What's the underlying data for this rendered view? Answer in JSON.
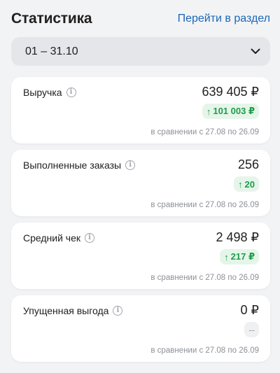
{
  "header": {
    "title": "Статистика",
    "link": "Перейти в раздел"
  },
  "period": {
    "value": "01 – 31.10"
  },
  "cards": [
    {
      "label": "Выручка",
      "value": "639 405 ₽",
      "delta": "101 003 ₽",
      "compare": "в сравнении с 27.08 по 26.09"
    },
    {
      "label": "Выполненные заказы",
      "value": "256",
      "delta": "20",
      "compare": "в сравнении с 27.08 по 26.09"
    },
    {
      "label": "Средний чек",
      "value": "2 498 ₽",
      "delta": "217 ₽",
      "compare": "в сравнении с 27.08 по 26.09"
    },
    {
      "label": "Упущенная выгода",
      "value": "0 ₽",
      "delta": "--",
      "compare": "в сравнении с 27.08 по 26.09"
    }
  ],
  "icons": {
    "info": "info-icon",
    "chevron": "chevron-down-icon",
    "arrow": "arrow-up-icon"
  },
  "colors": {
    "link": "#1a66b8",
    "positive": "#1e9e48",
    "positive_bg": "#e6f5ea"
  }
}
